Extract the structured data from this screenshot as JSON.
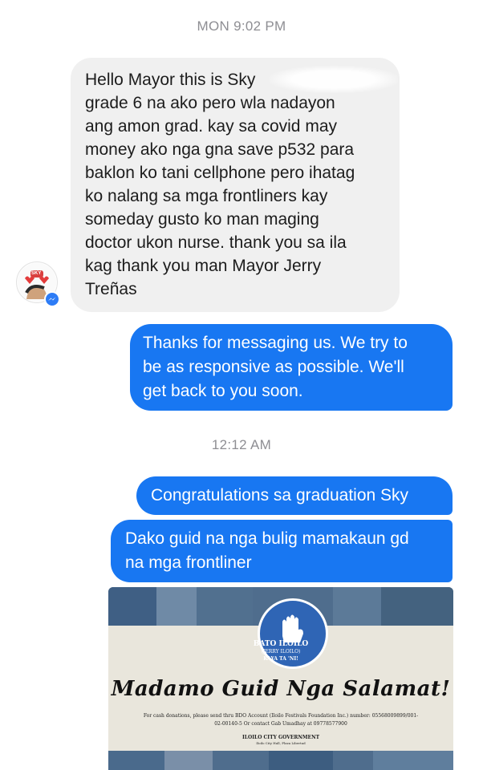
{
  "timestamps": {
    "first": "MON 9:02 PM",
    "second": "12:12 AM"
  },
  "incoming_message": {
    "lines": [
      "Hello Mayor this is Sky",
      "grade 6 na  ako pero wla nadayon",
      "ang amon grad. kay sa covid may",
      "money ako nga gna save p532 para",
      "baklon ko tani cellphone pero ihatag",
      "ko nalang sa mga frontliners kay",
      "someday gusto ko man maging",
      "doctor ukon nurse. thank you sa ila",
      "kag thank you man Mayor Jerry",
      "Treñas"
    ]
  },
  "avatar": {
    "label": "SKY",
    "badge_icon": "messenger-icon"
  },
  "outgoing_messages": [
    {
      "lines": [
        "Thanks for messaging us. We try to",
        "be as responsive as possible. We'll",
        "get back to you soon."
      ]
    },
    {
      "lines": [
        "Congratulations sa graduation Sky"
      ]
    },
    {
      "lines": [
        "Dako guid na nga bulig mamakaun gd",
        "na mga frontliner"
      ]
    }
  ],
  "image_attachment": {
    "seal_top": "BATO ILOILO",
    "seal_mid": "(JERRY ILOILO)",
    "seal_bottom": "KAYA TA 'NI!",
    "headline": "Madamo Guid Nga Salamat!",
    "donation_line1": "For cash donations, please send thru BDO Account (Iloilo Festivals Foundation Inc.) number: 05568009899/001-",
    "donation_line2": "02-00140-5 Or contact Gab Umadhay at 09778577900",
    "org": "ILOILO CITY GOVERNMENT",
    "address": "Iloilo City Hall, Plaza Libertad"
  },
  "colors": {
    "outgoing": "#1877f2",
    "incoming": "#f0f0f0",
    "timestamp": "#8e8e93"
  }
}
